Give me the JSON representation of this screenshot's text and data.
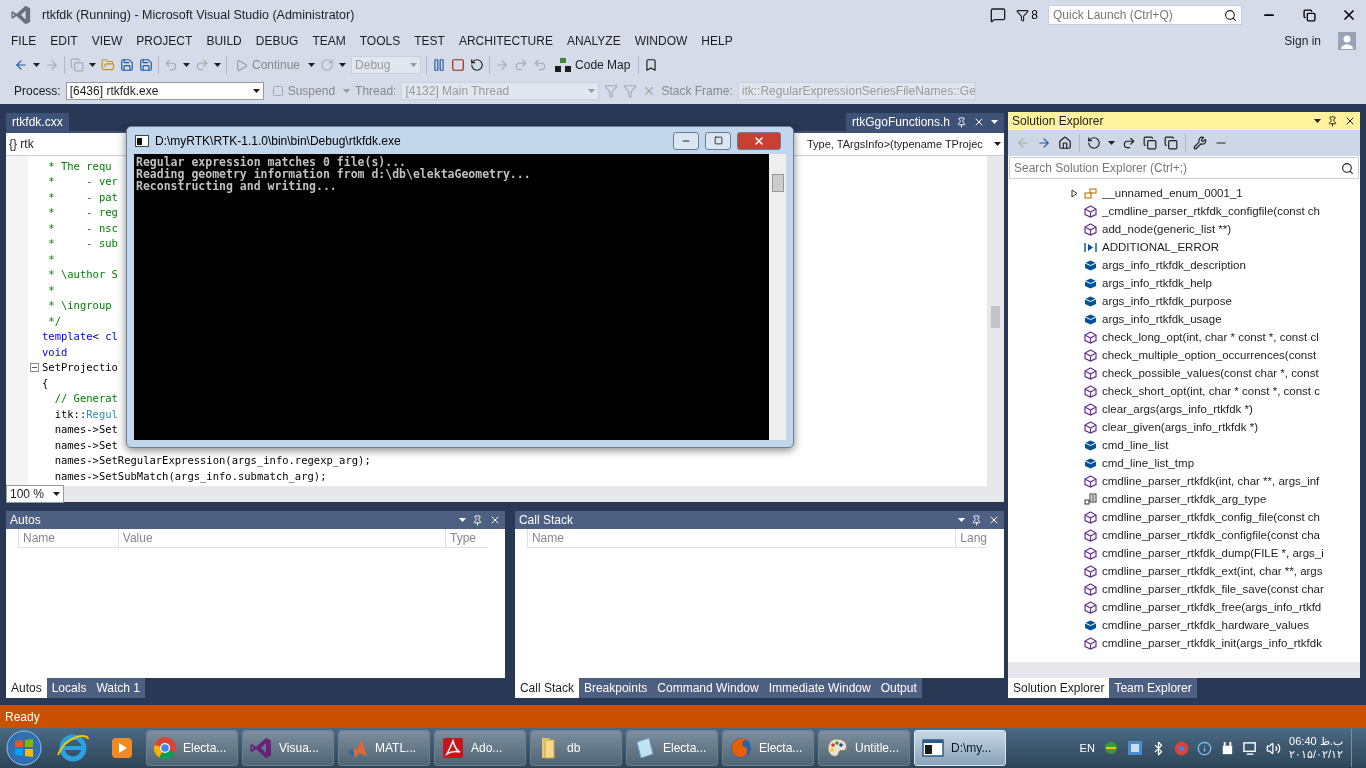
{
  "window": {
    "title": "rtkfdk (Running) - Microsoft Visual Studio (Administrator)",
    "notification_count": "8",
    "quick_launch": {
      "placeholder": "Quick Launch (Ctrl+Q)"
    }
  },
  "menu": {
    "items": [
      "FILE",
      "EDIT",
      "VIEW",
      "PROJECT",
      "BUILD",
      "DEBUG",
      "TEAM",
      "TOOLS",
      "TEST",
      "ARCHITECTURE",
      "ANALYZE",
      "WINDOW",
      "HELP"
    ],
    "sign_in": "Sign in"
  },
  "debug_toolbar": {
    "continue": "Continue",
    "configuration": "Debug",
    "code_map": "Code Map"
  },
  "location_toolbar": {
    "process_label": "Process:",
    "process": "[6436] rtkfdk.exe",
    "suspend": "Suspend",
    "thread_label": "Thread:",
    "thread": "[4132] Main Thread",
    "stack_frame_label": "Stack Frame:",
    "stack_frame": "itk::RegularExpressionSeriesFileNames::Ge"
  },
  "document_tabs": {
    "open_tab": {
      "label": "rtkfdk.cxx"
    },
    "preview_tab": {
      "label": "rtkGgoFunctions.h"
    }
  },
  "navigation_bar": {
    "scope": "{} rtk",
    "member": "Type, TArgsInfo>(typename TProjec"
  },
  "editor": {
    "zoom": "100 %",
    "lines": [
      {
        "tokens": [
          {
            "text": " * The requ",
            "kind": "comment"
          }
        ]
      },
      {
        "tokens": [
          {
            "text": " *     - ver",
            "kind": "comment"
          }
        ]
      },
      {
        "tokens": [
          {
            "text": " *     - pat",
            "kind": "comment"
          }
        ]
      },
      {
        "tokens": [
          {
            "text": " *     - reg",
            "kind": "comment"
          }
        ]
      },
      {
        "tokens": [
          {
            "text": " *     - nsc",
            "kind": "comment"
          }
        ]
      },
      {
        "tokens": [
          {
            "text": " *     - sub",
            "kind": "comment"
          }
        ]
      },
      {
        "tokens": [
          {
            "text": " *",
            "kind": "comment"
          }
        ]
      },
      {
        "tokens": [
          {
            "text": " * \\author S",
            "kind": "comment"
          }
        ]
      },
      {
        "tokens": [
          {
            "text": " *",
            "kind": "comment"
          }
        ]
      },
      {
        "tokens": [
          {
            "text": " * \\ingroup",
            "kind": "comment"
          }
        ]
      },
      {
        "tokens": [
          {
            "text": " */",
            "kind": "comment"
          }
        ]
      },
      {
        "tokens": [
          {
            "text": "template",
            "kind": "keyword"
          },
          {
            "text": "< ",
            "kind": "plain"
          },
          {
            "text": "cl",
            "kind": "keyword"
          }
        ]
      },
      {
        "tokens": [
          {
            "text": "void",
            "kind": "keyword"
          }
        ]
      },
      {
        "tokens": [
          {
            "text": "SetProjectio",
            "kind": "plain"
          }
        ],
        "expanded": true
      },
      {
        "tokens": [
          {
            "text": "{",
            "kind": "plain"
          }
        ]
      },
      {
        "tokens": [
          {
            "text": "  // Generat",
            "kind": "comment"
          }
        ]
      },
      {
        "tokens": [
          {
            "text": "  itk::",
            "kind": "plain"
          },
          {
            "text": "Regul",
            "kind": "type"
          }
        ]
      },
      {
        "tokens": [
          {
            "text": "  names->Set",
            "kind": "plain"
          }
        ]
      },
      {
        "tokens": [
          {
            "text": "  names->Set",
            "kind": "plain"
          }
        ]
      },
      {
        "tokens": [
          {
            "text": "  names->SetRegularExpression(args_info.regexp_arg);",
            "kind": "plain"
          }
        ]
      },
      {
        "tokens": [
          {
            "text": "  names->SetSubMatch(args_info.submatch_arg);",
            "kind": "plain"
          }
        ]
      }
    ]
  },
  "console": {
    "title": "D:\\myRTK\\RTK-1.1.0\\bin\\bin\\Debug\\rtkfdk.exe",
    "lines": [
      "Regular expression matches 0 file(s)...",
      "Reading geometry information from d:\\db\\elektaGeometry...",
      "Reconstructing and writing..."
    ]
  },
  "autos": {
    "title": "Autos",
    "columns": [
      "Name",
      "Value",
      "Type"
    ],
    "tabs": [
      {
        "label": "Autos",
        "selected": true
      },
      {
        "label": "Locals",
        "selected": false
      },
      {
        "label": "Watch 1",
        "selected": false
      }
    ]
  },
  "call_stack": {
    "title": "Call Stack",
    "columns": [
      "Name",
      "Lang"
    ],
    "tabs": [
      {
        "label": "Call Stack",
        "selected": true
      },
      {
        "label": "Breakpoints",
        "selected": false
      },
      {
        "label": "Command Window",
        "selected": false
      },
      {
        "label": "Immediate Window",
        "selected": false
      },
      {
        "label": "Output",
        "selected": false
      }
    ]
  },
  "solution_explorer": {
    "title": "Solution Explorer",
    "search": {
      "placeholder": "Search Solution Explorer (Ctrl+;)"
    },
    "items": [
      {
        "label": "__unnamed_enum_0001_1",
        "kind": "enum",
        "expanded": false
      },
      {
        "label": "_cmdline_parser_rtkfdk_configfile(const ch",
        "kind": "method"
      },
      {
        "label": "add_node(generic_list **)",
        "kind": "method"
      },
      {
        "label": "ADDITIONAL_ERROR",
        "kind": "constant"
      },
      {
        "label": "args_info_rtkfdk_description",
        "kind": "field"
      },
      {
        "label": "args_info_rtkfdk_help",
        "kind": "field"
      },
      {
        "label": "args_info_rtkfdk_purpose",
        "kind": "field"
      },
      {
        "label": "args_info_rtkfdk_usage",
        "kind": "field"
      },
      {
        "label": "check_long_opt(int, char * const *, const cl",
        "kind": "method"
      },
      {
        "label": "check_multiple_option_occurrences(const",
        "kind": "method"
      },
      {
        "label": "check_possible_values(const char *, const",
        "kind": "method"
      },
      {
        "label": "check_short_opt(int, char * const *, const c",
        "kind": "method"
      },
      {
        "label": "clear_args(args_info_rtkfdk *)",
        "kind": "method"
      },
      {
        "label": "clear_given(args_info_rtkfdk *)",
        "kind": "method"
      },
      {
        "label": "cmd_line_list",
        "kind": "field"
      },
      {
        "label": "cmd_line_list_tmp",
        "kind": "field"
      },
      {
        "label": "cmdline_parser_rtkfdk(int, char **, args_inf",
        "kind": "method"
      },
      {
        "label": "cmdline_parser_rtkfdk_arg_type",
        "kind": "typedef"
      },
      {
        "label": "cmdline_parser_rtkfdk_config_file(const ch",
        "kind": "method"
      },
      {
        "label": "cmdline_parser_rtkfdk_configfile(const cha",
        "kind": "method"
      },
      {
        "label": "cmdline_parser_rtkfdk_dump(FILE *, args_i",
        "kind": "method"
      },
      {
        "label": "cmdline_parser_rtkfdk_ext(int, char **, args",
        "kind": "method"
      },
      {
        "label": "cmdline_parser_rtkfdk_file_save(const char",
        "kind": "method"
      },
      {
        "label": "cmdline_parser_rtkfdk_free(args_info_rtkfd",
        "kind": "method"
      },
      {
        "label": "cmdline_parser_rtkfdk_hardware_values",
        "kind": "field"
      },
      {
        "label": "cmdline_parser_rtkfdk_init(args_info_rtkfdk",
        "kind": "method"
      }
    ],
    "tabs": [
      {
        "label": "Solution Explorer",
        "selected": true
      },
      {
        "label": "Team Explorer",
        "selected": false
      }
    ]
  },
  "status_bar": {
    "text": "Ready"
  },
  "taskbar": {
    "tasks": [
      {
        "label": "Electa...",
        "kind": "browser",
        "selected": false
      },
      {
        "label": "Visua...",
        "kind": "ide",
        "selected": false
      },
      {
        "label": "MATL...",
        "kind": "math",
        "selected": false
      },
      {
        "label": "Ado...",
        "kind": "pdf",
        "selected": false
      },
      {
        "label": "db",
        "kind": "folder",
        "selected": false
      },
      {
        "label": "Electa...",
        "kind": "notepad",
        "selected": false
      },
      {
        "label": "Electa...",
        "kind": "fox",
        "selected": false
      },
      {
        "label": "Untitle...",
        "kind": "paint",
        "selected": false
      },
      {
        "label": "D:\\my...",
        "kind": "console",
        "selected": true
      }
    ],
    "language": "EN",
    "time": "06:40",
    "period": "ب.ظ",
    "date": "۲۰۱۵/۰۲/۱۲"
  }
}
